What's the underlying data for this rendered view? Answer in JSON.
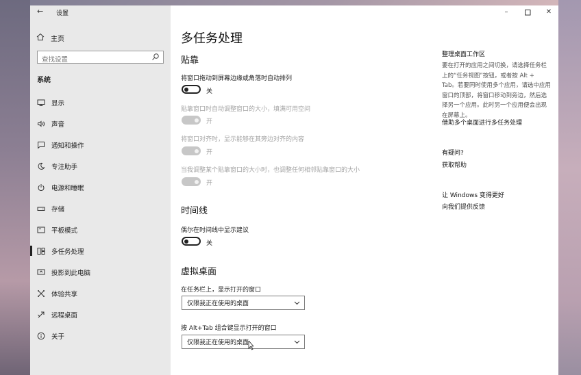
{
  "window": {
    "app_title": "设置"
  },
  "sidebar": {
    "home_label": "主页",
    "search_placeholder": "查找设置",
    "section_label": "系统",
    "items": [
      {
        "label": "显示",
        "icon": "monitor-icon"
      },
      {
        "label": "声音",
        "icon": "speaker-icon"
      },
      {
        "label": "通知和操作",
        "icon": "notification-icon"
      },
      {
        "label": "专注助手",
        "icon": "moon-icon"
      },
      {
        "label": "电源和睡眠",
        "icon": "power-icon"
      },
      {
        "label": "存储",
        "icon": "storage-icon"
      },
      {
        "label": "平板模式",
        "icon": "tablet-icon"
      },
      {
        "label": "多任务处理",
        "icon": "multitasking-icon",
        "active": true
      },
      {
        "label": "投影到此电脑",
        "icon": "project-icon"
      },
      {
        "label": "体验共享",
        "icon": "share-icon"
      },
      {
        "label": "远程桌面",
        "icon": "remote-desktop-icon"
      },
      {
        "label": "关于",
        "icon": "info-icon"
      }
    ]
  },
  "main": {
    "page_title": "多任务处理",
    "snap": {
      "heading": "贴靠",
      "options": [
        {
          "label": "将窗口拖动到屏幕边缘或角落时自动排列",
          "state": "关",
          "on": false,
          "enabled": true
        },
        {
          "label": "贴靠窗口时自动调整窗口的大小，填满可用空间",
          "state": "开",
          "on": true,
          "enabled": false
        },
        {
          "label": "将窗口对齐时，显示能够在其旁边对齐的内容",
          "state": "开",
          "on": true,
          "enabled": false
        },
        {
          "label": "当我调整某个贴靠窗口的大小时，也调整任何相邻贴靠窗口的大小",
          "state": "开",
          "on": true,
          "enabled": false
        }
      ]
    },
    "timeline": {
      "heading": "时间线",
      "option": {
        "label": "偶尔在时间线中显示建议",
        "state": "关",
        "on": false
      }
    },
    "virtual_desktops": {
      "heading": "虚拟桌面",
      "taskbar_label": "在任务栏上，显示打开的窗口",
      "taskbar_value": "仅限我正在使用的桌面",
      "alttab_label": "按 Alt+Tab 组合键显示打开的窗口",
      "alttab_value": "仅限我正在使用的桌面"
    }
  },
  "aside": {
    "heading": "整理桌面工作区",
    "body": "要在打开的应用之间切换，请选择任务栏上的“任务视图”按钮，或者按 Alt + Tab。若要同时使用多个应用，请选中应用窗口的顶部，将窗口移动到旁边，然后选择另一个应用。此时另一个应用便会出现在屏幕上。",
    "link_snap": "借助多个桌面进行多任务处理",
    "questions_heading": "有疑问?",
    "help_link": "获取帮助",
    "improve_heading": "让 Windows 变得更好",
    "feedback_link": "向我们提供反馈"
  }
}
